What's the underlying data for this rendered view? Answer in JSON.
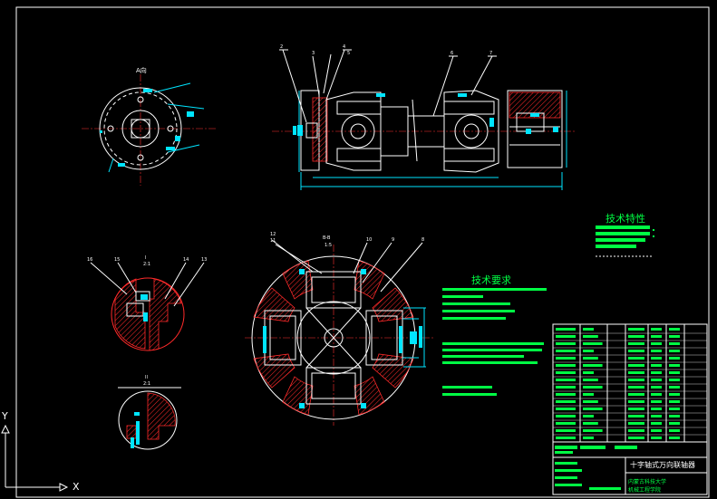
{
  "drawing": {
    "view_a_label": "A向",
    "section_b_label": "B-B",
    "section_b_scale": "1:5",
    "detail_i_label": "I",
    "detail_i_scale": "2:1",
    "detail_ii_label": "II",
    "detail_ii_scale": "2:1",
    "top_callouts": [
      "2",
      "3",
      "4",
      "5",
      "6",
      "7"
    ],
    "section_callouts": [
      "12",
      "11",
      "10",
      "9",
      "8"
    ],
    "detail_callouts": [
      "16",
      "15",
      "14",
      "13"
    ],
    "tech_char_title": "技术特性",
    "tech_req_title": "技术要求",
    "title_block_name": "十字轴式万向联轴器",
    "title_block_school": "内蒙古科技大学",
    "title_block_dept": "机械工程学院",
    "axis_x": "X",
    "axis_y": "Y"
  },
  "colors": {
    "background": "#000000",
    "white_lines": "#ffffff",
    "cyan_dims": "#00e5ff",
    "green_text": "#00ff44",
    "red_hatch": "#ff2a2a"
  }
}
